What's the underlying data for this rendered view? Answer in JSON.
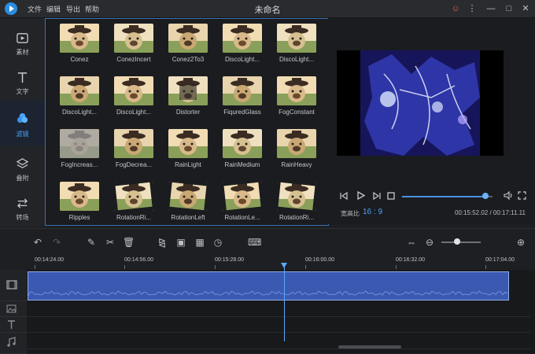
{
  "app": {
    "title": "未命名",
    "menu": [
      "文件",
      "编辑",
      "导出",
      "帮助"
    ],
    "window_icons": [
      "user-alert-icon",
      "more-vert-icon",
      "minimize-icon",
      "maximize-icon",
      "close-icon"
    ]
  },
  "sidebar": {
    "items": [
      {
        "label": "素材",
        "icon": "media-icon",
        "active": false
      },
      {
        "label": "文字",
        "icon": "text-icon",
        "active": false
      },
      {
        "label": "滤镜",
        "icon": "filter-icon",
        "active": true
      },
      {
        "label": "叠附",
        "icon": "overlay-icon",
        "active": false
      },
      {
        "label": "转场",
        "icon": "transition-icon",
        "active": false
      }
    ]
  },
  "filters": [
    {
      "name": "Conez"
    },
    {
      "name": "ConezIncert"
    },
    {
      "name": "Conez2To3"
    },
    {
      "name": "DiscoLight..."
    },
    {
      "name": "DiscoLight..."
    },
    {
      "name": "DiscoLight..."
    },
    {
      "name": "DiscoLight..."
    },
    {
      "name": "Distorter"
    },
    {
      "name": "FiquredGlass"
    },
    {
      "name": "FogConstant"
    },
    {
      "name": "FogIncreas..."
    },
    {
      "name": "FogDecrea..."
    },
    {
      "name": "RainLight"
    },
    {
      "name": "RainMedium"
    },
    {
      "name": "RainHeavy"
    },
    {
      "name": "Ripples"
    },
    {
      "name": "RotationRi..."
    },
    {
      "name": "RotationLeft"
    },
    {
      "name": "RotationLe..."
    },
    {
      "name": "RotationRi..."
    }
  ],
  "preview": {
    "aspect_label": "宽高比",
    "aspect_value": "16 : 9",
    "time": "00:15:52.02 / 00:17:11.11",
    "progress": 0.92
  },
  "timeline": {
    "ticks": [
      "00:14:24.00",
      "00:14:56.00",
      "00:15:28.00",
      "00:16:00.00",
      "00:16:32.00",
      "00:17:04.00"
    ]
  },
  "colors": {
    "accent": "#4aa3ff",
    "clip": "#3b59b1",
    "panel_border": "#3a72b4"
  }
}
